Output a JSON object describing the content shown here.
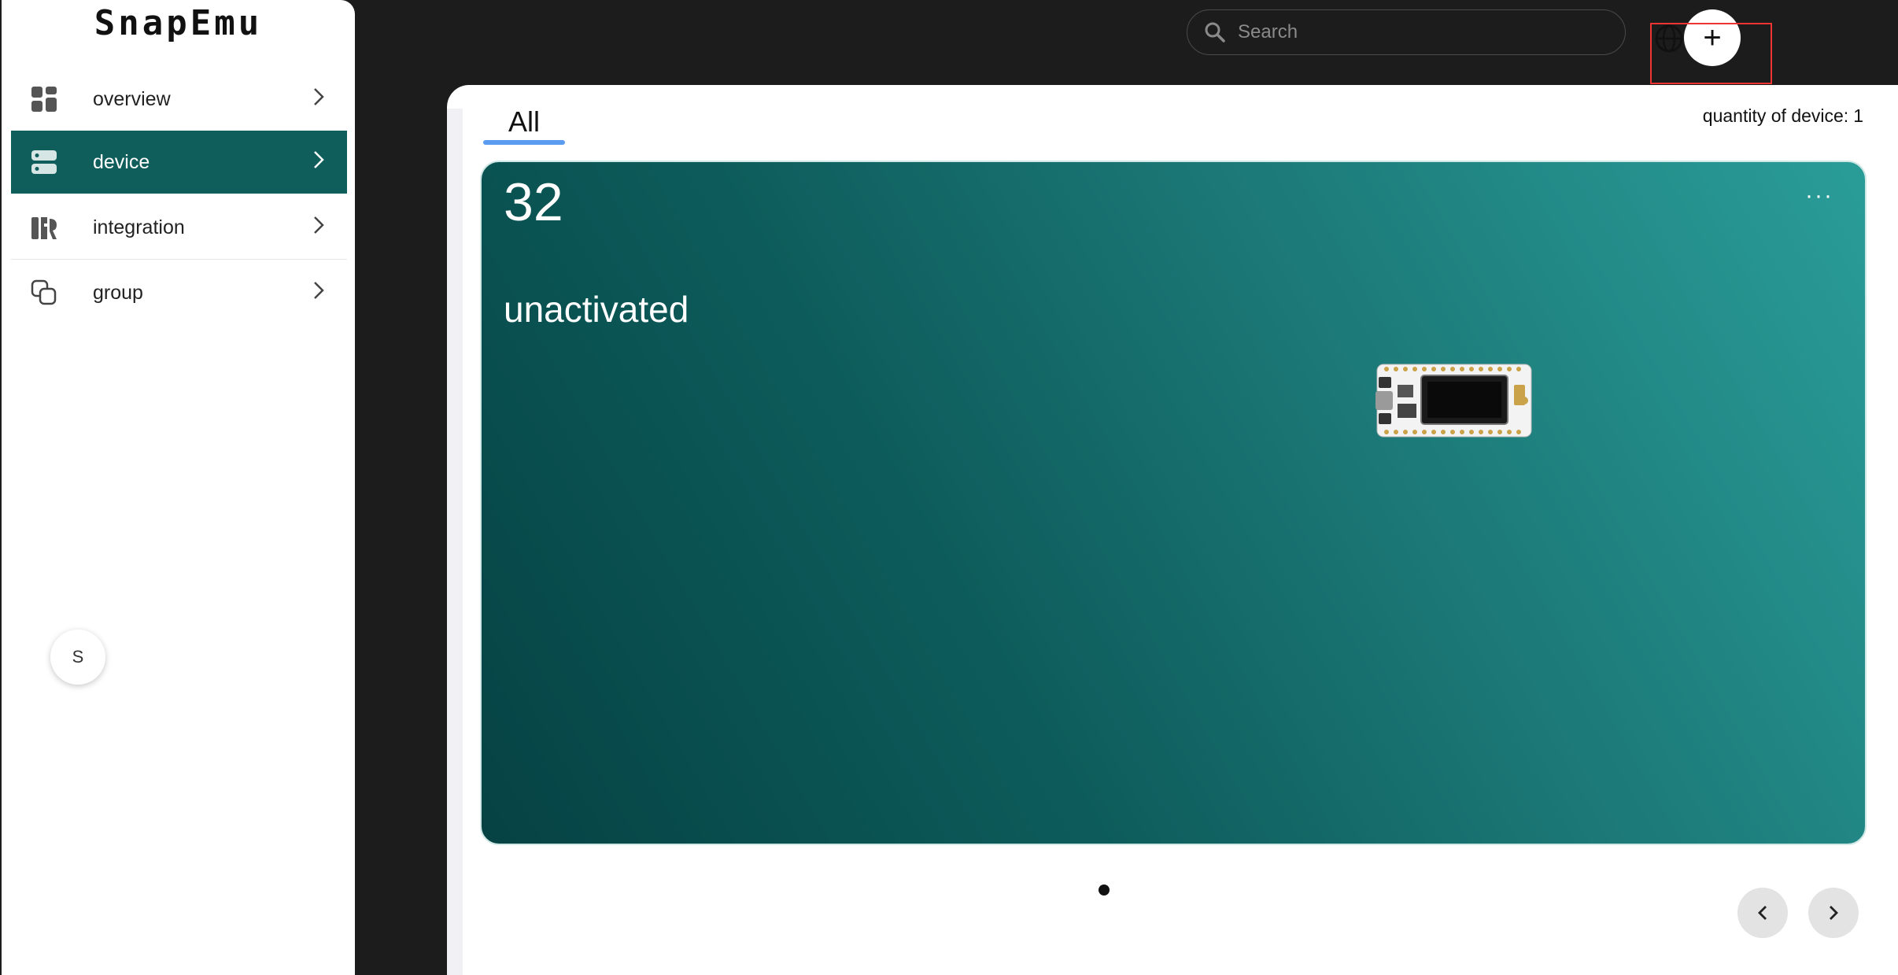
{
  "app": {
    "logo": "SnapEmu"
  },
  "sidebar": {
    "items": [
      {
        "label": "overview",
        "icon": "grid-icon",
        "active": false
      },
      {
        "label": "device",
        "icon": "server-icon",
        "active": true
      },
      {
        "label": "integration",
        "icon": "integration-icon",
        "active": false
      },
      {
        "label": "group",
        "icon": "group-icon",
        "active": false
      }
    ],
    "avatar": "S"
  },
  "header": {
    "search_placeholder": "Search",
    "add_label": "+"
  },
  "main": {
    "tabs": [
      {
        "label": "All",
        "active": true
      }
    ],
    "quantity_label": "quantity of device:",
    "quantity_value": "1",
    "card": {
      "name": "32",
      "status": "unactivated",
      "more": "···"
    },
    "pager": {
      "dots": 1,
      "active": 0
    }
  },
  "colors": {
    "accent": "#0f5e5c",
    "tab_underline": "#5b9bf0",
    "highlight": "#e33333"
  }
}
